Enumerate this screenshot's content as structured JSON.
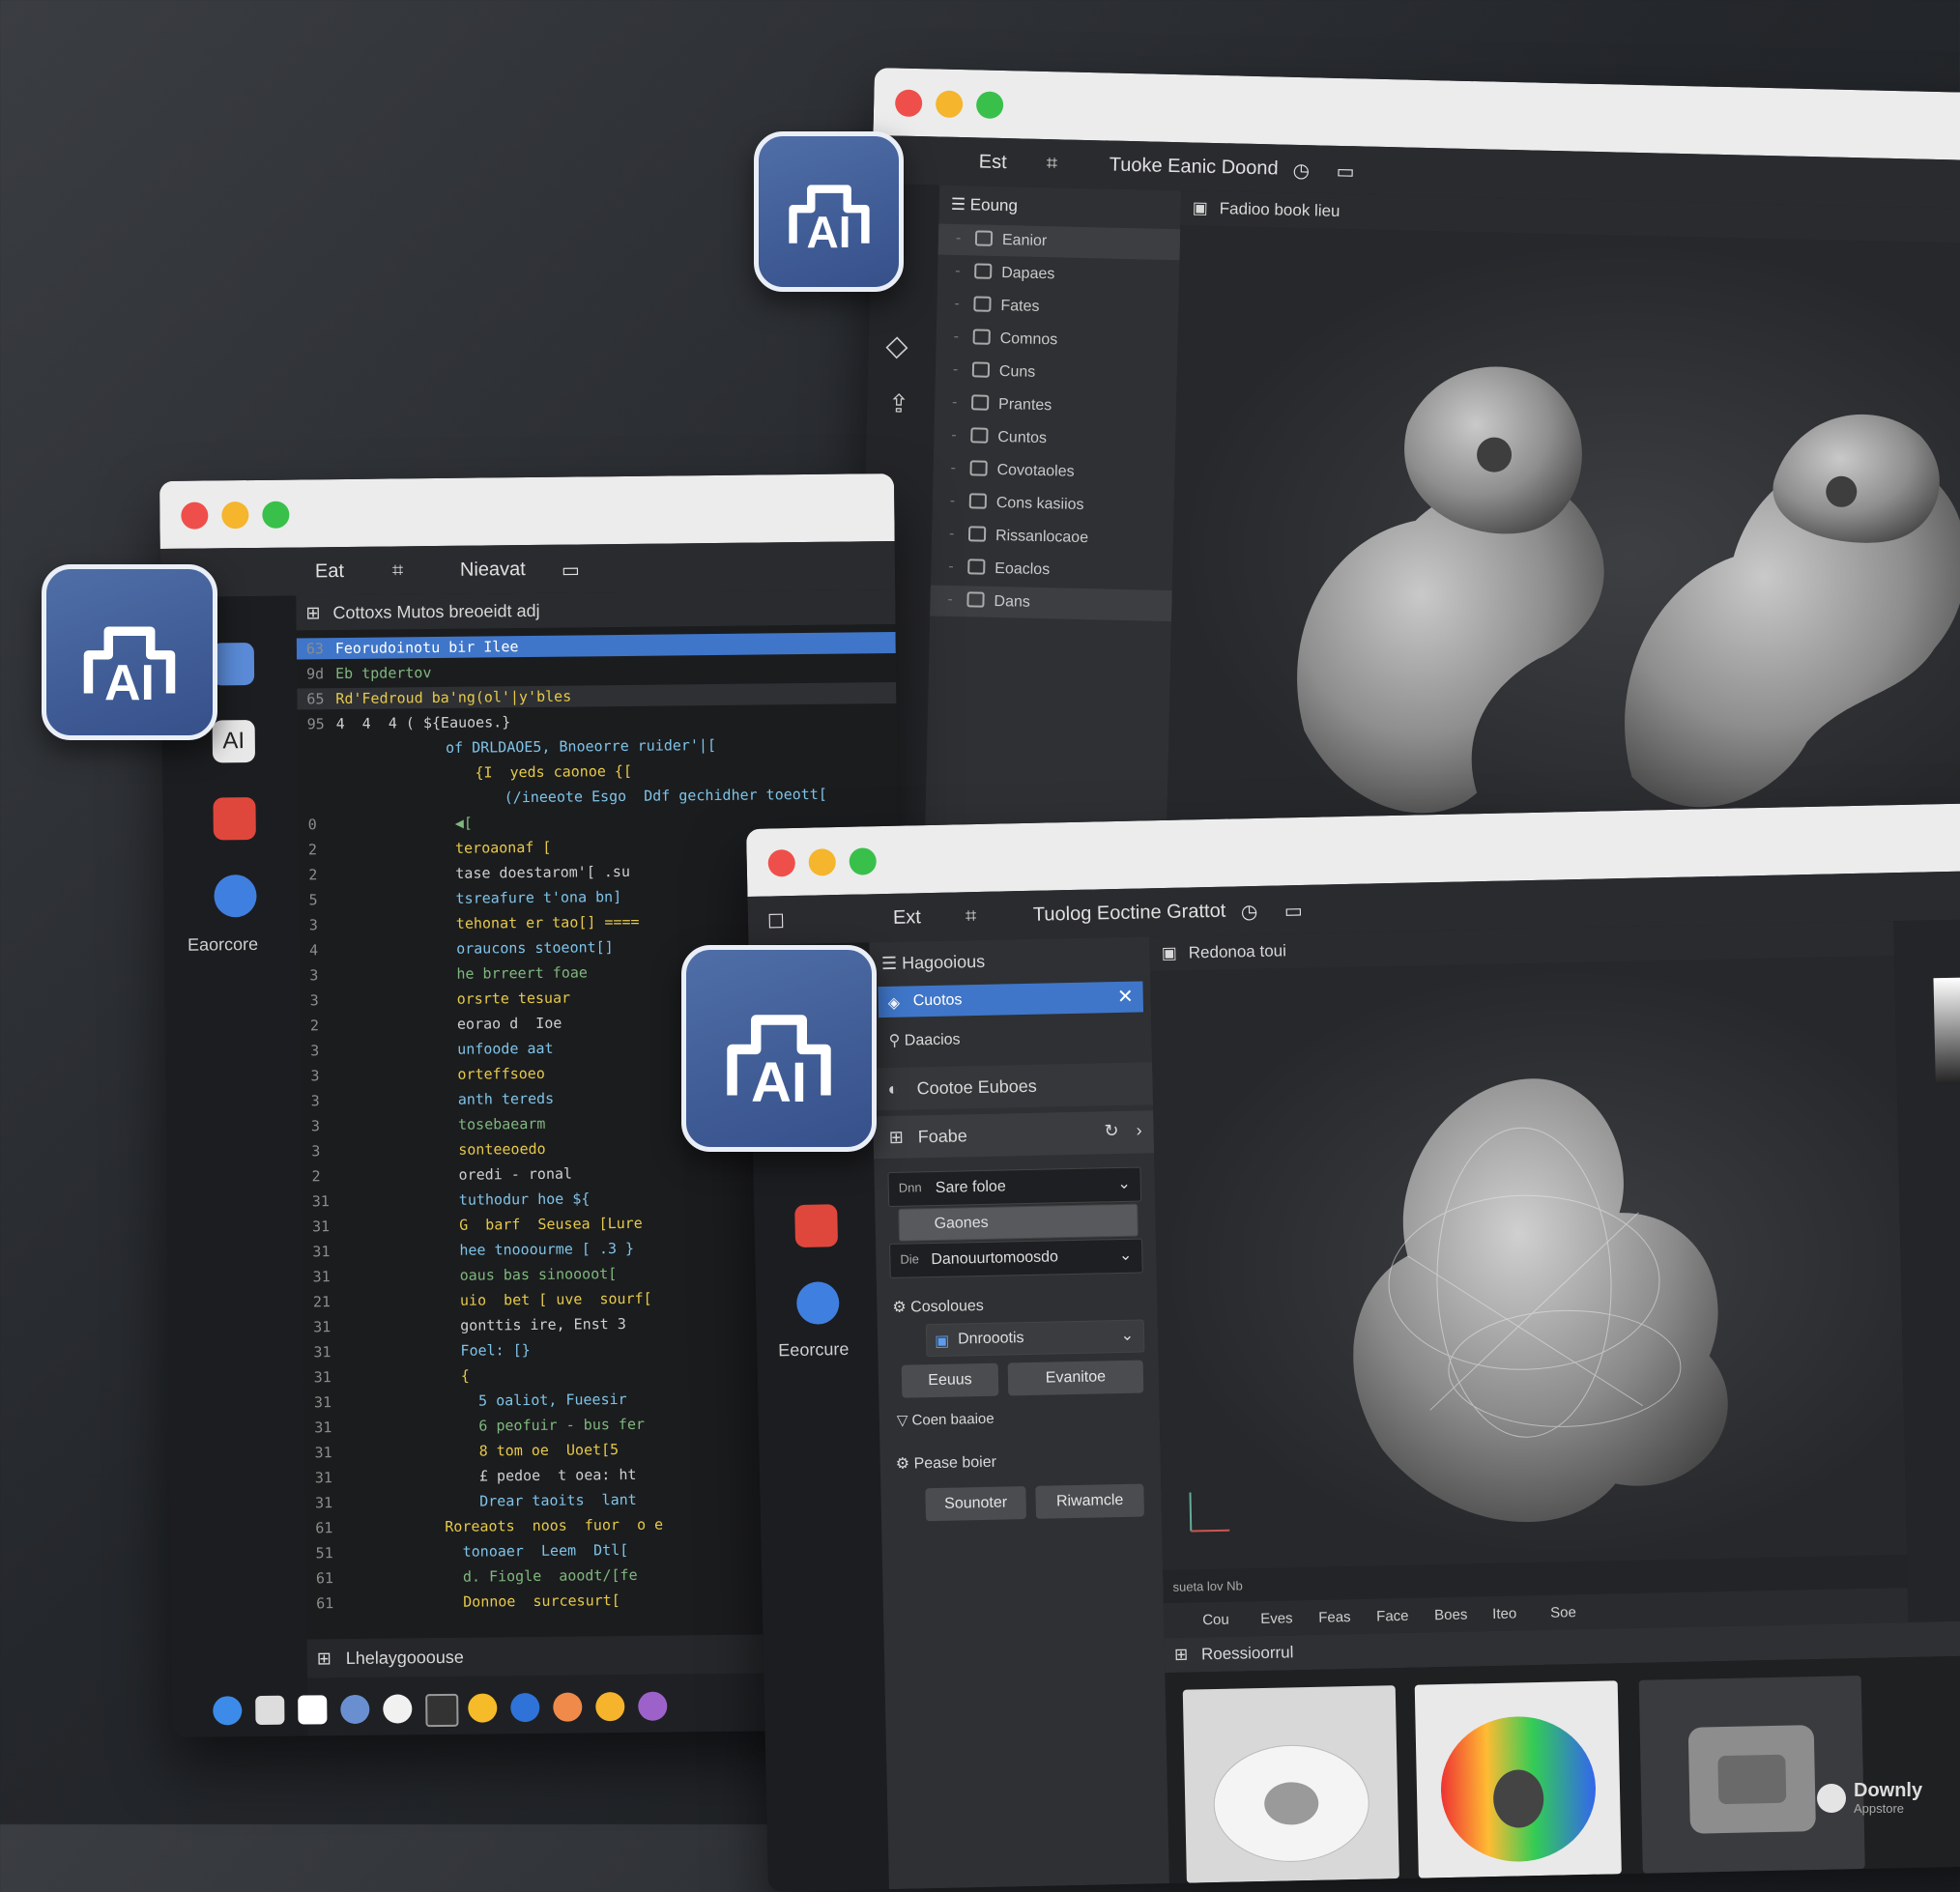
{
  "badge_label": "AI",
  "back_window": {
    "menu": {
      "edit": "Est",
      "title": "Tuoke Eanic Doond"
    },
    "outliner_header": "Eoung",
    "viewport_header": "Fadioo book lieu",
    "tree": [
      {
        "label": "Eanior",
        "selected": true
      },
      {
        "label": "Dapaes"
      },
      {
        "label": "Fates"
      },
      {
        "label": "Comnos"
      },
      {
        "label": "Cuns"
      },
      {
        "label": "Prantes"
      },
      {
        "label": "Cuntos"
      },
      {
        "label": "Covotaoles"
      },
      {
        "label": "Cons kasiios"
      },
      {
        "label": "Rissanlocaoe"
      },
      {
        "label": "Eoaclos"
      },
      {
        "label": "Dans",
        "highlight": true
      }
    ]
  },
  "code_window": {
    "menu": {
      "edit": "Eat",
      "title": "Nieavat"
    },
    "file_header": "Cottoxs Mutos breoeidt adj",
    "sidebar_caption": "Eaorcore",
    "sidebar_badge": "AI",
    "status": "Lhelaygooouse",
    "lines": [
      {
        "n": "63",
        "t": "Feorudoinotu bir Ilee",
        "hl": "blue"
      },
      {
        "n": "9d",
        "t": "Eb tpdertov",
        "hl": ""
      },
      {
        "n": "65",
        "t": "Rd'Fedroud ba'ng(ol'|y'bles",
        "hl": "dark"
      },
      {
        "n": "95",
        "t": "4  4  4 ( ${Eauoes.}",
        "hl": ""
      },
      {
        "n": "",
        "t": "     of DRLDAOE5, Bnoeorre ruider'|[",
        "hl": ""
      },
      {
        "n": "",
        "t": "       {I  yeds caonoe {[",
        "hl": ""
      },
      {
        "n": "",
        "t": "         (/ineeote Esgo  Ddf gechidher toeott[",
        "hl": ""
      },
      {
        "n": "0",
        "t": "  ◀[",
        "hl": ""
      },
      {
        "n": "2",
        "t": "  teroaonaf [",
        "hl": ""
      },
      {
        "n": "2",
        "t": "  tase doestarom'[ .su",
        "hl": ""
      },
      {
        "n": "5",
        "t": "  tsreafure t'ona bn]",
        "hl": ""
      },
      {
        "n": "3",
        "t": "  tehonat er tao[] ====",
        "hl": ""
      },
      {
        "n": "4",
        "t": "  oraucons stoeont[]",
        "hl": ""
      },
      {
        "n": "3",
        "t": "  he brreert foae",
        "hl": ""
      },
      {
        "n": "3",
        "t": "  orsrte tesuar",
        "hl": ""
      },
      {
        "n": "2",
        "t": "  eorao d  Ioe",
        "hl": ""
      },
      {
        "n": "3",
        "t": "  unfoode aat",
        "hl": ""
      },
      {
        "n": "3",
        "t": "  orteffsoeo",
        "hl": ""
      },
      {
        "n": "3",
        "t": "  anth tereds",
        "hl": ""
      },
      {
        "n": "3",
        "t": "  tosebaearm",
        "hl": ""
      },
      {
        "n": "3",
        "t": "  sonteeoedo",
        "hl": ""
      },
      {
        "n": "2",
        "t": "  oredi - ronal",
        "hl": ""
      },
      {
        "n": "31",
        "t": "  tuthodur hoe ${",
        "hl": ""
      },
      {
        "n": "31",
        "t": "  G  barf  Seusea [Lure",
        "hl": ""
      },
      {
        "n": "31",
        "t": "  hee tnooourme [ .3 }",
        "hl": ""
      },
      {
        "n": "31",
        "t": "  oaus bas sinoooot[",
        "hl": ""
      },
      {
        "n": "21",
        "t": "  uio  bet [ uve  sourf[",
        "hl": ""
      },
      {
        "n": "31",
        "t": "  gonttis ire, Enst 3",
        "hl": ""
      },
      {
        "n": "31",
        "t": "  Foel: [}",
        "hl": ""
      },
      {
        "n": "31",
        "t": "  {",
        "hl": ""
      },
      {
        "n": "31",
        "t": "    5 oaliot, Fueesir",
        "hl": ""
      },
      {
        "n": "31",
        "t": "    6 peofuir - bus fer",
        "hl": ""
      },
      {
        "n": "31",
        "t": "    8 tom oe  Uoet[5",
        "hl": ""
      },
      {
        "n": "31",
        "t": "    £ pedoe  t oea: ht",
        "hl": ""
      },
      {
        "n": "31",
        "t": "    Drear taoits  lant",
        "hl": ""
      },
      {
        "n": "61",
        "t": "Roreaots  noos  fuor  o e",
        "hl": ""
      },
      {
        "n": "51",
        "t": "  tonoaer  Leem  Dtl[",
        "hl": ""
      },
      {
        "n": "61",
        "t": "  d. Fiogle  aoodt/[fe",
        "hl": ""
      },
      {
        "n": "61",
        "t": "  Donnoe  surcesurt[",
        "hl": ""
      }
    ]
  },
  "front_window": {
    "menu": {
      "edit": "Ext",
      "title": "Tuolog Eoctine Grattot"
    },
    "sidebar_caption": "Eeorcure",
    "panel_header": "Hagooious",
    "items": {
      "selected": "Cuotos",
      "item2": "Daacios",
      "section1": "Cootoe Euboes",
      "section2": "Foabe"
    },
    "fields": {
      "f1_label": "Dnn",
      "f1_value": "Sare foloe",
      "f2_value": "Gaones",
      "f3_label": "Die",
      "f3_value": "Danouurtomoosdo"
    },
    "section3": "Cosoloues",
    "dropdown": "Dnroootis",
    "btn_a": "Eeuus",
    "btn_b": "Evanitoe",
    "item_cond": "Coen baaioe",
    "section4": "Pease boier",
    "btn_c": "Sounoter",
    "btn_d": "Riwamcle",
    "viewport_header": "Redonoa toui",
    "tabs": [
      "Cou",
      "Eves",
      "Feas",
      "Face",
      "Boes",
      "Iteo",
      "Soe"
    ],
    "strip_label": "sueta  lov   Nb",
    "asset_header": "Roessioorrul"
  },
  "watermark": {
    "title": "Downly",
    "sub": "Appstore"
  }
}
